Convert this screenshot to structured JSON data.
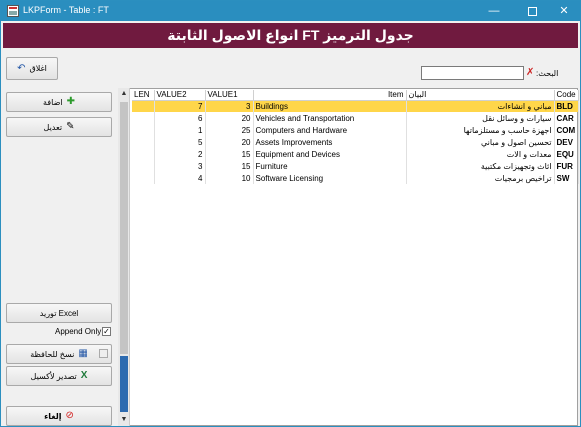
{
  "window": {
    "title": "LKPForm - Table : FT",
    "minimize": "—",
    "close": "✕"
  },
  "header": {
    "title": "جدول الترميز FT انواع الاصول الثابتة"
  },
  "buttons": {
    "close": "اغلاق",
    "add": "اضافة",
    "edit": "تعديل",
    "import_excel": "توريد Excel",
    "append_only": "Append Only",
    "copy_to_portfolio": "نسخ للحافظة",
    "export_excel": "تصدير لأكسيل",
    "cancel": "إلغاء"
  },
  "search": {
    "label": "البحث:",
    "value": "",
    "placeholder": ""
  },
  "grid": {
    "columns": {
      "len": "LEN",
      "value2": "VALUE2",
      "value1": "VALUE1",
      "item": "Item",
      "desc": "البيان",
      "code": "Code"
    },
    "rows": [
      {
        "len": "",
        "value2": "7",
        "value1": "3",
        "item": "Buildings",
        "desc": "مباني و انشاءات",
        "code": "BLD"
      },
      {
        "len": "",
        "value2": "6",
        "value1": "20",
        "item": "Vehicles and Transportation",
        "desc": "سيارات و وسائل نقل",
        "code": "CAR"
      },
      {
        "len": "",
        "value2": "1",
        "value1": "25",
        "item": "Computers and Hardware",
        "desc": "اجهزة حاسب و مستلزماتها",
        "code": "COM"
      },
      {
        "len": "",
        "value2": "5",
        "value1": "20",
        "item": "Assets Improvements",
        "desc": "تحسين اصول و مباني",
        "code": "DEV"
      },
      {
        "len": "",
        "value2": "2",
        "value1": "15",
        "item": "Equipment and Devices",
        "desc": "معدات و الات",
        "code": "EQU"
      },
      {
        "len": "",
        "value2": "3",
        "value1": "15",
        "item": "Furniture",
        "desc": "اثاث وتجهيزات مكتبية",
        "code": "FUR"
      },
      {
        "len": "",
        "value2": "4",
        "value1": "10",
        "item": "Software Licensing",
        "desc": "تراخيص برمجيات",
        "code": "SW"
      }
    ]
  },
  "colors": {
    "titlebar": "#2a8ebf",
    "header": "#701a3f",
    "selected_row": "#ffd64a",
    "scroll_dark": "#2d6bb0"
  }
}
